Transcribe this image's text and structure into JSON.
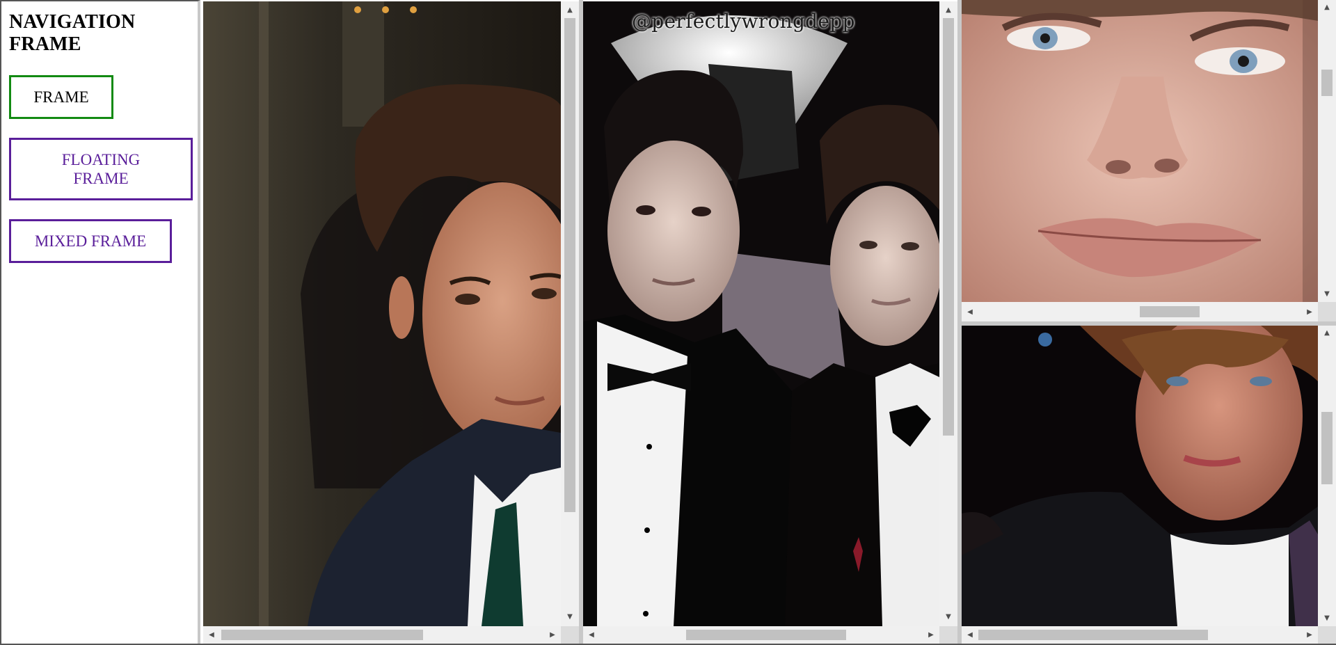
{
  "nav": {
    "title": "NAVIGATION FRAME",
    "buttons": [
      {
        "label": "FRAME"
      },
      {
        "label": "FLOATING FRAME"
      },
      {
        "label": "MIXED FRAME"
      }
    ]
  },
  "frames": [
    {
      "subject": "portrait-1"
    },
    {
      "subject": "portrait-pair",
      "watermark": "@perfectlywrongdepp"
    },
    {
      "subject": "face-closeup"
    },
    {
      "subject": "portrait-2"
    }
  ],
  "colors": {
    "frame_button": "#128a12",
    "visited_button": "#5a1e9a",
    "scrollbar_track": "#f0f0f0",
    "scrollbar_thumb": "#c1c1c1",
    "frame_border": "#c8c8c8"
  }
}
